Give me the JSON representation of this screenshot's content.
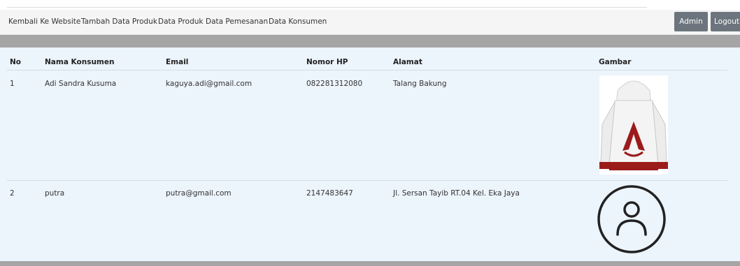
{
  "nav": {
    "links": [
      "Kembali Ke Website",
      "Tambah Data Produk",
      "Data Produk",
      "Data Pemesanan",
      "Data Konsumen"
    ],
    "admin_label": "Admin",
    "logout_label": "Logout"
  },
  "table": {
    "headers": [
      "No",
      "Nama Konsumen",
      "Email",
      "Nomor HP",
      "Alamat",
      "Gambar"
    ],
    "rows": [
      {
        "no": "1",
        "nama": "Adi Sandra Kusuma",
        "email": "kaguya.adi@gmail.com",
        "hp": "082281312080",
        "alamat": "Talang Bakung",
        "gambar_icon": "hoodie-image"
      },
      {
        "no": "2",
        "nama": "putra",
        "email": "putra@gmail.com",
        "hp": "2147483647",
        "alamat": "Jl. Sersan Tayib RT.04 Kel. Eka Jaya",
        "gambar_icon": "user-icon"
      }
    ]
  },
  "colors": {
    "panel_bg": "#ecf4fc",
    "bar_grey": "#a5a5a5",
    "button_grey": "#6c757d",
    "hoodie_red": "#9b1b1b"
  }
}
